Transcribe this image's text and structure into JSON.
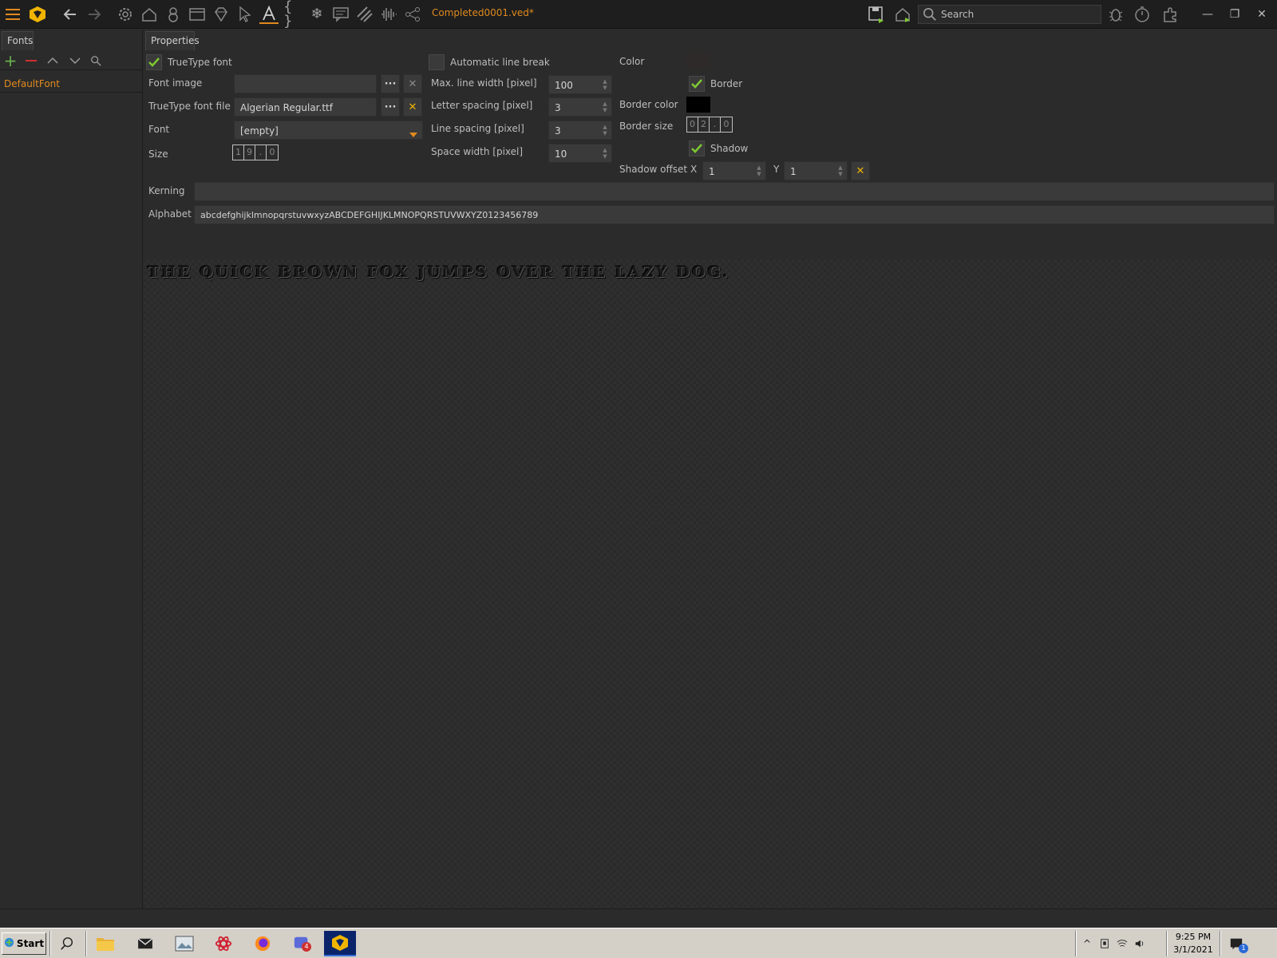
{
  "toolbar": {
    "document_title": "Completed0001.ved*",
    "search_placeholder": "Search",
    "icons": [
      "menu-icon",
      "logo-icon",
      "back-arrow-icon",
      "forward-arrow-icon",
      "settings-gear-icon",
      "home-icon",
      "object-icon",
      "window-icon",
      "diamond-icon",
      "pointer-icon",
      "font-icon",
      "braces-icon",
      "snowflake-icon",
      "message-icon",
      "stripes-icon",
      "audio-wave-icon",
      "share-icon",
      "save-icon",
      "home-run-icon",
      "search-icon",
      "bug-icon",
      "timer-icon",
      "plugin-icon"
    ]
  },
  "left_panel": {
    "tab_label": "Fonts",
    "items": [
      {
        "label": "DefaultFont"
      }
    ]
  },
  "properties": {
    "tab_label": "Properties",
    "truetype_font": {
      "label": "TrueType font",
      "checked": true
    },
    "font_image": {
      "label": "Font image",
      "value": ""
    },
    "truetype_font_file": {
      "label": "TrueType font file",
      "value": "Algerian Regular.ttf"
    },
    "font": {
      "label": "Font",
      "value": "[empty]"
    },
    "size": {
      "label": "Size",
      "digits": [
        "1",
        "9",
        ".",
        "0"
      ]
    },
    "automatic_line_break": {
      "label": "Automatic line break",
      "checked": false
    },
    "max_line_width": {
      "label": "Max. line width [pixel]",
      "value": "100"
    },
    "letter_spacing": {
      "label": "Letter spacing [pixel]",
      "value": "3"
    },
    "line_spacing": {
      "label": "Line spacing [pixel]",
      "value": "3"
    },
    "space_width": {
      "label": "Space width [pixel]",
      "value": "10"
    },
    "color": {
      "label": "Color",
      "hex": "#2e2a2a"
    },
    "border": {
      "label": "Border",
      "checked": true
    },
    "border_color": {
      "label": "Border color",
      "hex": "#000000"
    },
    "border_size": {
      "label": "Border size",
      "digits": [
        "0",
        "2",
        ".",
        "0"
      ]
    },
    "shadow": {
      "label": "Shadow",
      "checked": true
    },
    "shadow_offset": {
      "label": "Shadow offset",
      "x_label": "X",
      "x_value": "1",
      "y_label": "Y",
      "y_value": "1"
    },
    "kerning": {
      "label": "Kerning",
      "value": ""
    },
    "alphabet": {
      "label": "Alphabet",
      "value": "abcdefghijklmnopqrstuvwxyzABCDEFGHIJKLMNOPQRSTUVWXYZ0123456789"
    }
  },
  "preview": {
    "text": "THE QUICK BROWN FOX JUMPS OVER THE LAZY DOG."
  },
  "taskbar": {
    "start_label": "Start",
    "time": "9:25 PM",
    "date": "3/1/2021",
    "notification_count": "1",
    "chat_badge": "4"
  },
  "colors": {
    "accent": "#e08a1e",
    "check": "#7ec832",
    "clear_x": "#f0b400",
    "add": "#6ab04c",
    "remove": "#d03030"
  }
}
